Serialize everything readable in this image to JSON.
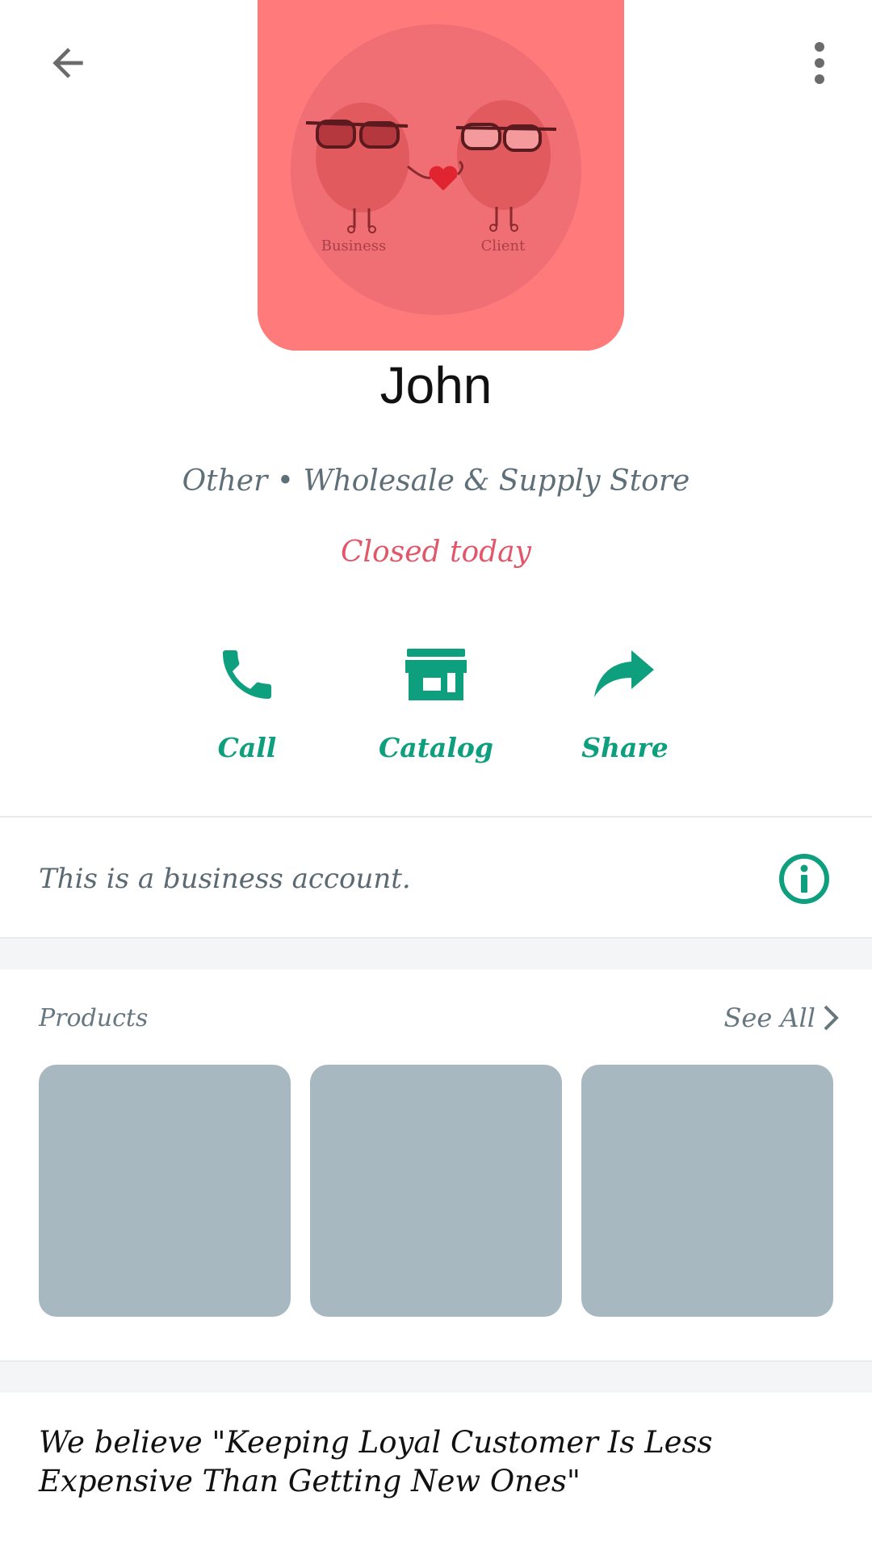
{
  "topbar": {
    "back_icon": "arrow-left-icon",
    "menu_icon": "more-vertical-icon"
  },
  "avatar": {
    "left_label": "Business",
    "right_label": "Client",
    "background_color": "#ff7b7b"
  },
  "profile": {
    "name": "John",
    "category": "Other • Wholesale & Supply Store",
    "hours_status": "Closed today"
  },
  "actions": [
    {
      "label": "Call",
      "icon": "phone-icon"
    },
    {
      "label": "Catalog",
      "icon": "storefront-icon"
    },
    {
      "label": "Share",
      "icon": "share-arrow-icon"
    }
  ],
  "info": {
    "text": "This is a business account.",
    "icon": "info-icon"
  },
  "products": {
    "label": "Products",
    "see_all_label": "See All",
    "see_all_icon": "chevron-right-icon",
    "tile_count": 3
  },
  "about": {
    "text": "We believe \"Keeping Loyal Customer Is Less Expensive Than Getting New Ones\""
  },
  "colors": {
    "accent": "#0e9f7e",
    "closed": "#e2566a",
    "secondary_text": "#5f6f78",
    "tile": "#a8b8c0"
  }
}
